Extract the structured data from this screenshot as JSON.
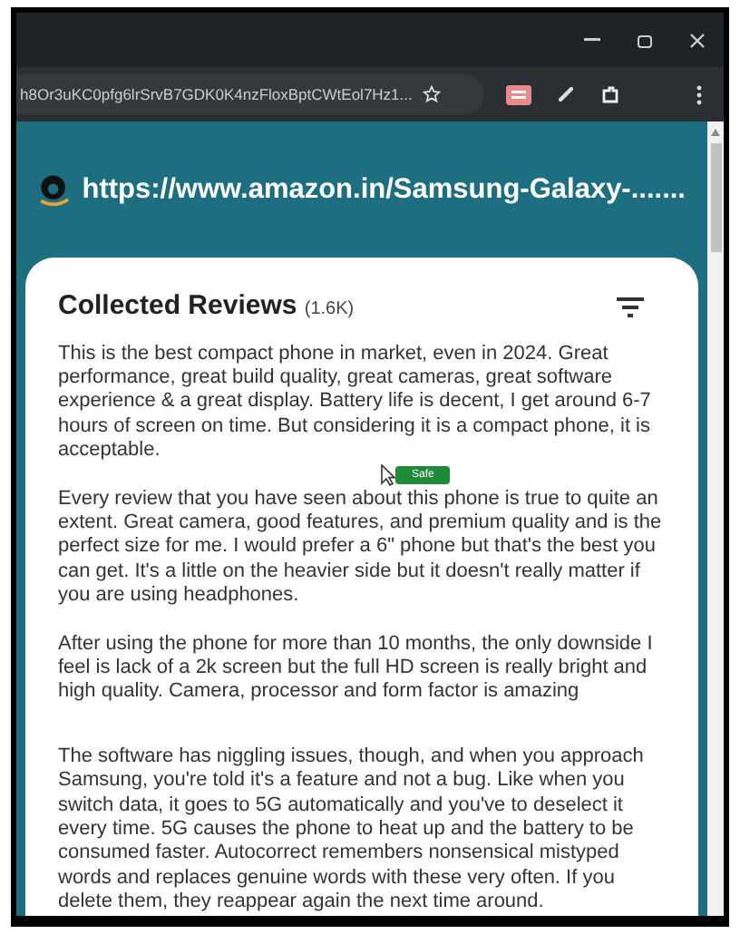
{
  "browser": {
    "address": "h8Or3uKC0pfg6lrSrvB7GDK0K4nzFloxBptCWtEol7Hz1..."
  },
  "header": {
    "url": "https://www.amazon.in/Samsung-Galaxy-......."
  },
  "panel": {
    "title": "Collected Reviews",
    "count": "(1.6K)"
  },
  "reviews": [
    {
      "text": "This is the best compact phone in market, even in 2024. Great performance, great build quality, great cameras, great software experience & a great display. Battery life is decent, I get around 6-7 hours of screen on time. But considering it is a compact phone, it is acceptable."
    },
    {
      "text": "Every review that you have seen about this phone is true to quite an extent. Great camera, good features, and premium quality and is the perfect size for me. I would prefer a 6\" phone but that's the best you can get. It's a little on the heavier side but it doesn't really matter if you are using headphones."
    },
    {
      "text": "After using the phone for more than 10 months, the only downside I feel is lack of a 2k screen but the full HD screen is really bright and high quality. Camera, processor and form factor is amazing"
    },
    {
      "text": "The software has niggling issues, though, and when you approach Samsung, you're told it's a feature and not a bug. Like when you switch data, it goes to 5G automatically and you've to deselect it every time. 5G causes the phone to heat up and the battery to be consumed faster. Autocorrect remembers nonsensical mistyped words and replaces genuine words with these very often. If you delete them, they reappear again the next time around."
    }
  ],
  "tooltip": {
    "label": "Safe"
  }
}
